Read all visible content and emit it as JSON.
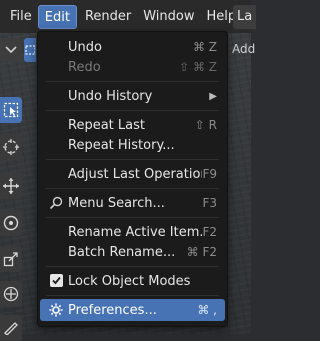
{
  "menubar": {
    "items": [
      "File",
      "Edit",
      "Render",
      "Window",
      "Help"
    ],
    "partial_tab": "La"
  },
  "header": {
    "add_label": "Add"
  },
  "menu": {
    "undo": {
      "label": "Undo",
      "shortcut": "⌘ Z"
    },
    "redo": {
      "label": "Redo",
      "shortcut": "⇧ ⌘ Z"
    },
    "undo_history": {
      "label": "Undo History"
    },
    "repeat_last": {
      "label": "Repeat Last",
      "shortcut": "⇧ R"
    },
    "repeat_history": {
      "label": "Repeat History..."
    },
    "adjust_last": {
      "label": "Adjust Last Operation...",
      "shortcut": "F9"
    },
    "menu_search": {
      "label": "Menu Search...",
      "shortcut": "F3"
    },
    "rename_active": {
      "label": "Rename Active Item...",
      "shortcut": "F2"
    },
    "batch_rename": {
      "label": "Batch Rename...",
      "shortcut": "⌘ F2"
    },
    "lock_object_modes": {
      "label": "Lock Object Modes",
      "checked": true
    },
    "preferences": {
      "label": "Preferences...",
      "shortcut": "⌘ ,"
    }
  },
  "colors": {
    "accent": "#4772b3",
    "menu_bg": "#1b1b1b"
  }
}
